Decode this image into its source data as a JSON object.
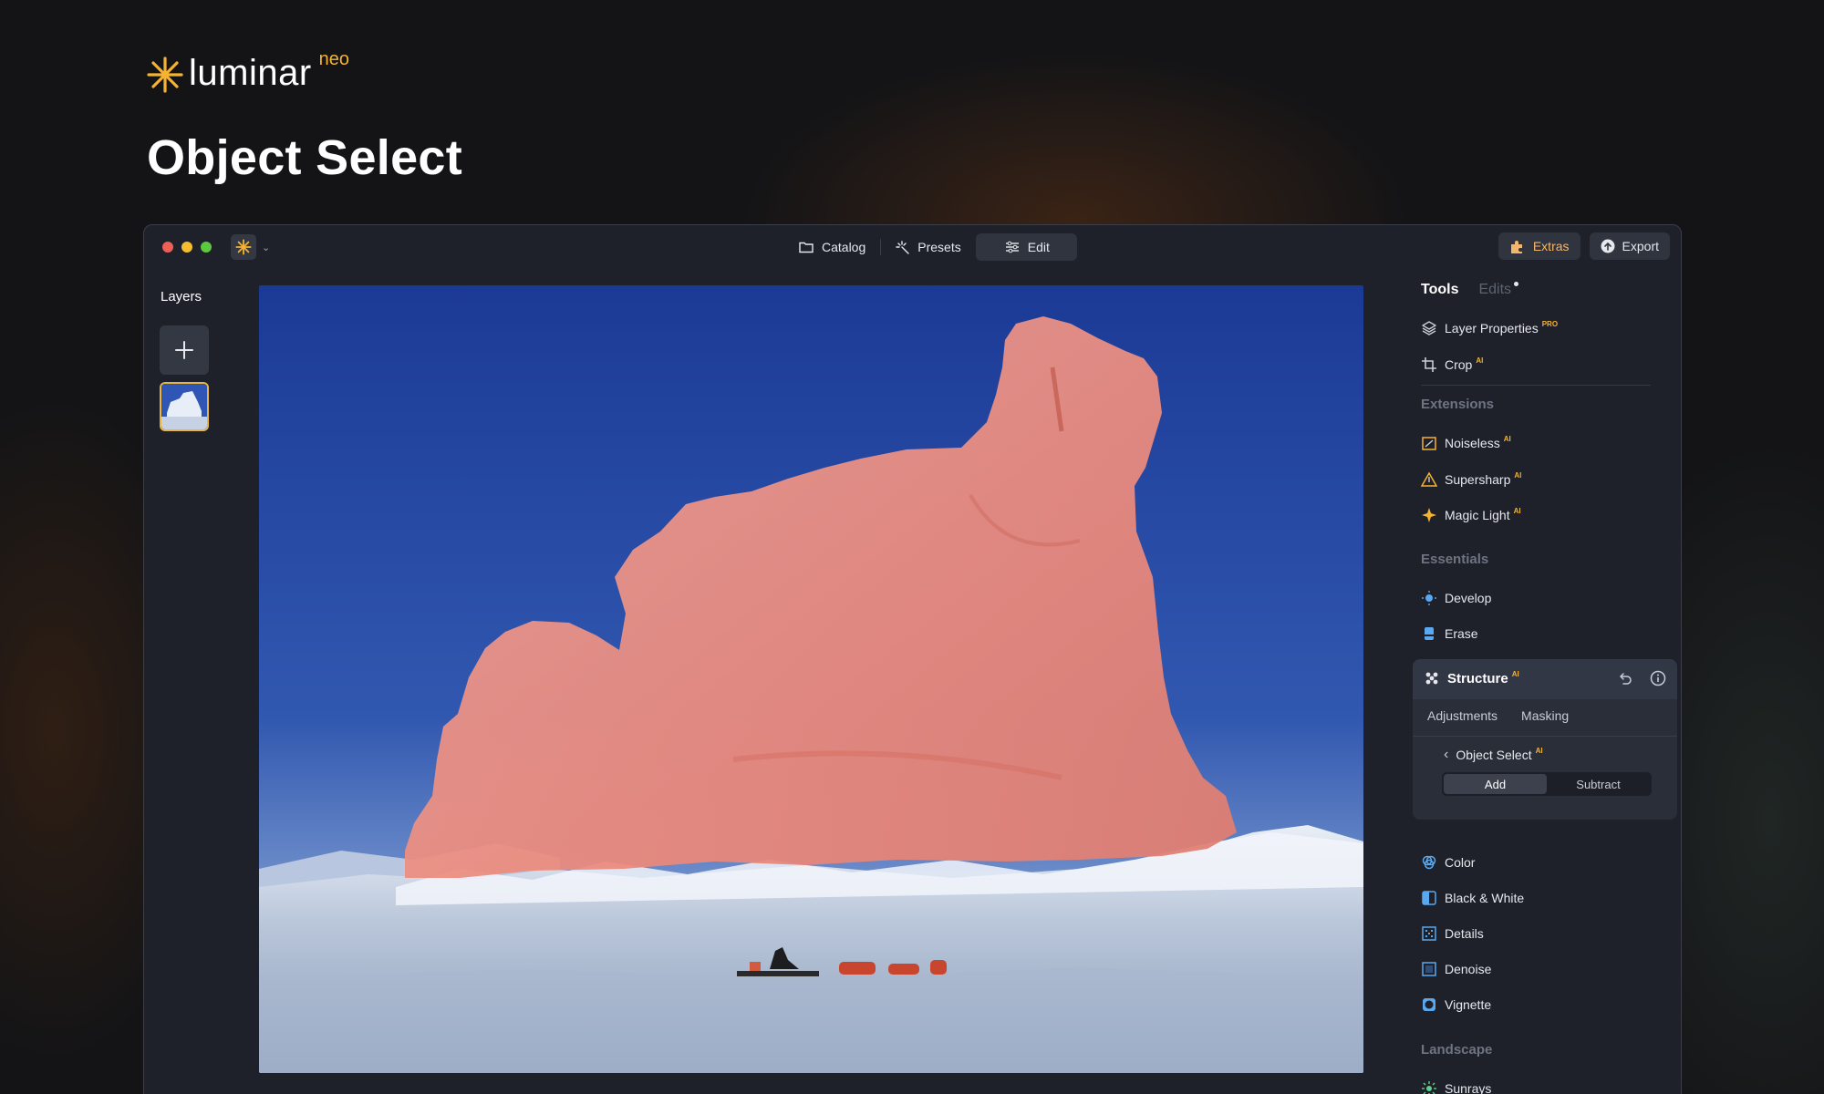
{
  "brand": {
    "name": "luminar",
    "suffix": "neo"
  },
  "page_title": "Object Select",
  "titlebar": {
    "nav": [
      {
        "label": "Catalog",
        "icon": "folder-icon"
      },
      {
        "label": "Presets",
        "icon": "sparkle-icon"
      },
      {
        "label": "Edit",
        "icon": "sliders-icon",
        "active": true
      }
    ],
    "extras_label": "Extras",
    "export_label": "Export"
  },
  "layers": {
    "title": "Layers"
  },
  "panel": {
    "tabs": {
      "tools": "Tools",
      "edits": "Edits"
    },
    "top_tools": [
      {
        "label": "Layer Properties",
        "badge": "PRO",
        "icon": "layers-icon"
      },
      {
        "label": "Crop",
        "badge": "AI",
        "icon": "crop-icon"
      }
    ],
    "extensions": {
      "title": "Extensions",
      "items": [
        {
          "label": "Noiseless",
          "badge": "AI",
          "icon": "noiseless-icon"
        },
        {
          "label": "Supersharp",
          "badge": "AI",
          "icon": "supersharp-icon"
        },
        {
          "label": "Magic Light",
          "badge": "AI",
          "icon": "magic-light-icon"
        }
      ]
    },
    "essentials": {
      "title": "Essentials",
      "items": [
        {
          "label": "Develop",
          "icon": "sun-icon"
        },
        {
          "label": "Erase",
          "icon": "eraser-icon"
        }
      ]
    },
    "structure": {
      "title": "Structure",
      "badge": "AI",
      "subtabs": [
        "Adjustments",
        "Masking"
      ],
      "object_select": "Object Select",
      "object_select_badge": "AI",
      "mode": {
        "add": "Add",
        "subtract": "Subtract",
        "selected": "Add"
      }
    },
    "more_tools": [
      {
        "label": "Color",
        "icon": "color-icon"
      },
      {
        "label": "Black & White",
        "icon": "bw-icon"
      },
      {
        "label": "Details",
        "icon": "details-icon"
      },
      {
        "label": "Denoise",
        "icon": "denoise-icon"
      },
      {
        "label": "Vignette",
        "icon": "vignette-icon"
      }
    ],
    "landscape": {
      "title": "Landscape",
      "items": [
        {
          "label": "Sunrays",
          "icon": "sunrays-icon"
        }
      ]
    }
  },
  "colors": {
    "accent": "#f5b331",
    "mask": "#f0857a",
    "sky": "#2b4fa8"
  }
}
